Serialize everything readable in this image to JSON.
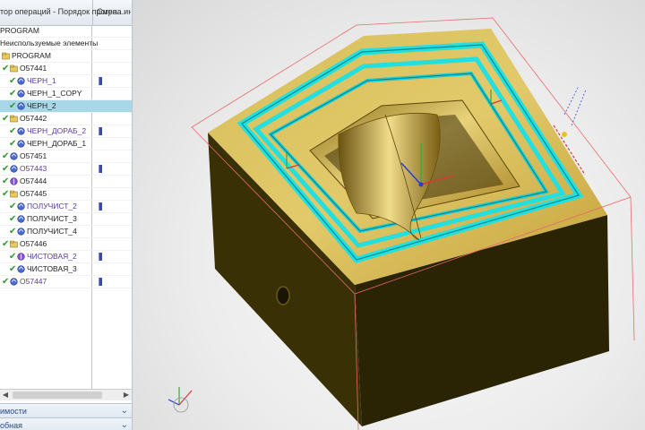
{
  "navigator": {
    "header_name": "тор операций - Порядок програ...",
    "header_col2": "Смена ин",
    "rows": [
      {
        "label": "PROGRAM",
        "style": "plain",
        "indent": 0,
        "icon": "none",
        "check": false,
        "bar": false,
        "selected": false
      },
      {
        "label": "Неиспользуемые элементы",
        "style": "plain",
        "indent": 0,
        "icon": "none",
        "check": false,
        "bar": false,
        "selected": false
      },
      {
        "label": "PROGRAM",
        "style": "plain",
        "indent": 1,
        "icon": "folder",
        "check": false,
        "bar": false,
        "selected": false
      },
      {
        "label": "O57441",
        "style": "plain",
        "indent": 1,
        "icon": "folder",
        "check": true,
        "bar": false,
        "selected": false
      },
      {
        "label": "ЧЕРН_1",
        "style": "link",
        "indent": 2,
        "icon": "op",
        "check": true,
        "bar": true,
        "selected": false
      },
      {
        "label": "ЧЕРН_1_COPY",
        "style": "plain",
        "indent": 2,
        "icon": "op",
        "check": true,
        "bar": false,
        "selected": false
      },
      {
        "label": "ЧЕРН_2",
        "style": "plain",
        "indent": 2,
        "icon": "op",
        "check": true,
        "bar": false,
        "selected": true
      },
      {
        "label": "O57442",
        "style": "plain",
        "indent": 1,
        "icon": "folder",
        "check": true,
        "bar": false,
        "selected": false
      },
      {
        "label": "ЧЕРН_ДОРАБ_2",
        "style": "link",
        "indent": 2,
        "icon": "op",
        "check": true,
        "bar": true,
        "selected": false
      },
      {
        "label": "ЧЕРН_ДОРАБ_1",
        "style": "plain",
        "indent": 2,
        "icon": "op",
        "check": true,
        "bar": false,
        "selected": false
      },
      {
        "label": "O57451",
        "style": "plain",
        "indent": 1,
        "icon": "op",
        "check": true,
        "bar": false,
        "selected": false
      },
      {
        "label": "O57443",
        "style": "link",
        "indent": 1,
        "icon": "op",
        "check": true,
        "bar": true,
        "selected": false
      },
      {
        "label": "O57444",
        "style": "plain",
        "indent": 1,
        "icon": "drill",
        "check": true,
        "bar": false,
        "selected": false
      },
      {
        "label": "O57445",
        "style": "plain",
        "indent": 1,
        "icon": "folder",
        "check": true,
        "bar": false,
        "selected": false
      },
      {
        "label": "ПОЛУЧИСТ_2",
        "style": "link",
        "indent": 2,
        "icon": "op",
        "check": true,
        "bar": true,
        "selected": false
      },
      {
        "label": "ПОЛУЧИСТ_3",
        "style": "plain",
        "indent": 2,
        "icon": "op",
        "check": true,
        "bar": false,
        "selected": false
      },
      {
        "label": "ПОЛУЧИСТ_4",
        "style": "plain",
        "indent": 2,
        "icon": "op",
        "check": true,
        "bar": false,
        "selected": false
      },
      {
        "label": "O57446",
        "style": "plain",
        "indent": 1,
        "icon": "folder",
        "check": true,
        "bar": false,
        "selected": false
      },
      {
        "label": "ЧИСТОВАЯ_2",
        "style": "link",
        "indent": 2,
        "icon": "drill",
        "check": true,
        "bar": true,
        "selected": false
      },
      {
        "label": "ЧИСТОВАЯ_3",
        "style": "plain",
        "indent": 2,
        "icon": "op",
        "check": true,
        "bar": false,
        "selected": false
      },
      {
        "label": "O57447",
        "style": "link",
        "indent": 1,
        "icon": "op",
        "check": true,
        "bar": true,
        "selected": false
      }
    ]
  },
  "panels": {
    "dependencies": "имости",
    "details": "обная"
  },
  "colors": {
    "check": "#2e9a2e",
    "link": "#5a3a9c",
    "selected_row": "#a8d8e8",
    "gold": "#c8a838",
    "toolpath": "#22e0e0"
  }
}
